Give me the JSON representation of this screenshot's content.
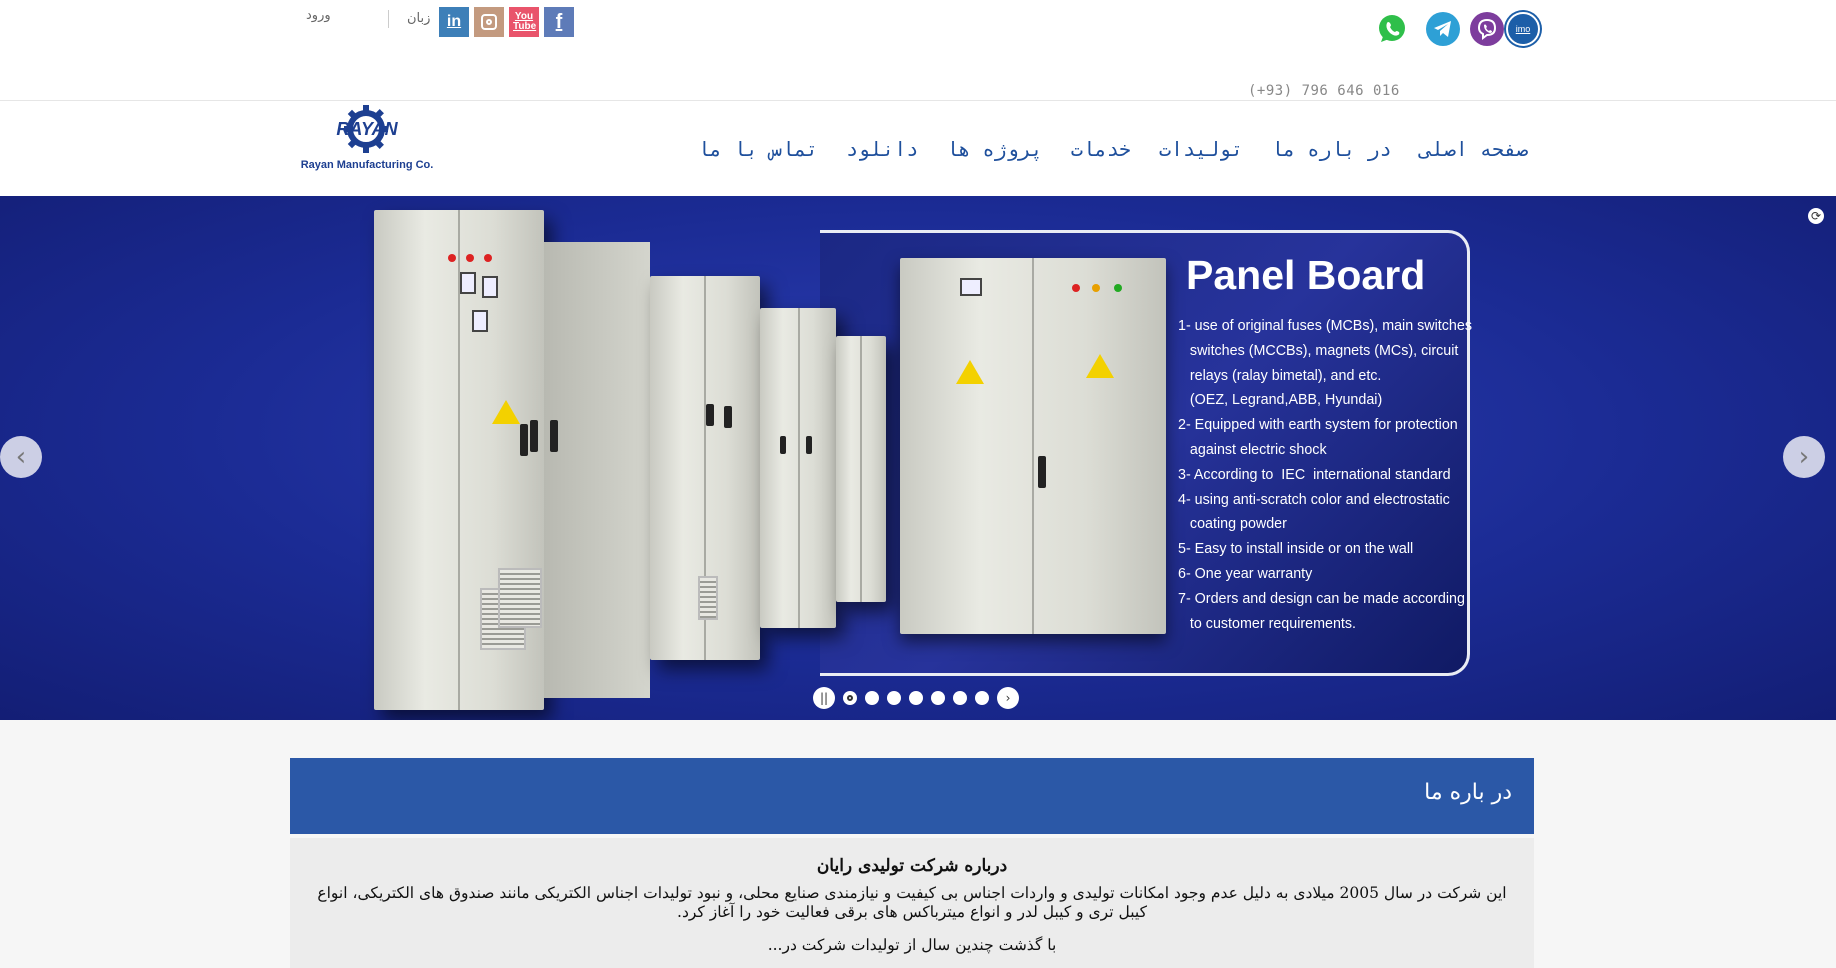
{
  "topbar": {
    "login": "ورود",
    "language": "زبان",
    "phone": "(+93) 796 646 016",
    "social": [
      "linkedin-icon",
      "instagram-icon",
      "youtube-icon",
      "facebook-icon"
    ],
    "messengers": [
      "whatsapp-icon",
      "telegram-icon",
      "viber-icon",
      "imo-icon"
    ],
    "linkedin_glyph": "in",
    "youtube_glyph": "You Tube",
    "facebook_glyph": "f",
    "imo_glyph": "imo"
  },
  "logo": {
    "word": "RAYAN",
    "subtitle": "Rayan Manufacturing Co."
  },
  "nav": {
    "items": [
      "صفحه اصلی",
      "در باره ما",
      "تولیدات",
      "خدمات",
      "پروژه ها",
      "دانلود",
      "تماس با ما"
    ]
  },
  "slider": {
    "title": "Panel Board",
    "lines": [
      "1- use of original fuses (MCBs), main switches",
      "   switches (MCCBs), magnets (MCs), circuit",
      "   relays (ralay bimetal), and etc.",
      "   (OEZ, Legrand,ABB, Hyundai)",
      "2- Equipped with earth system for protection",
      "   against electric shock",
      "3- According to  IEC  international standard",
      "4- using anti-scratch color and electrostatic",
      "   coating powder",
      "5- Easy to install inside or on the wall",
      "6- One year warranty",
      "7- Orders and design can be made according",
      "   to customer requirements."
    ],
    "prev_glyph": "‹",
    "next_glyph": "›",
    "pause_glyph": "||",
    "play_glyph": "›",
    "slide_count": 7,
    "active_slide": 1
  },
  "about": {
    "title": "در باره ما",
    "heading": "درباره شرکت تولیدی رایان",
    "text": "این شرکت در سال 2005 میلادی به دلیل عدم وجود امکانات تولیدی و واردات اجناس بی کیفیت و نیازمندی صنایع محلی، و نبود تولیدات اجناس الکتریکی مانند صندوق های الکتریکی، انواع کیبل تری و کیبل لدر و انواع میترباکس های برقی فعالیت خود را آغاز کرد.",
    "more": "با گذشت چندین سال از تولیدات شرکت در..."
  },
  "colors": {
    "brand": "#1e4f9c",
    "about_header": "#2b58a7",
    "slider_bg": "#1b2b94"
  }
}
